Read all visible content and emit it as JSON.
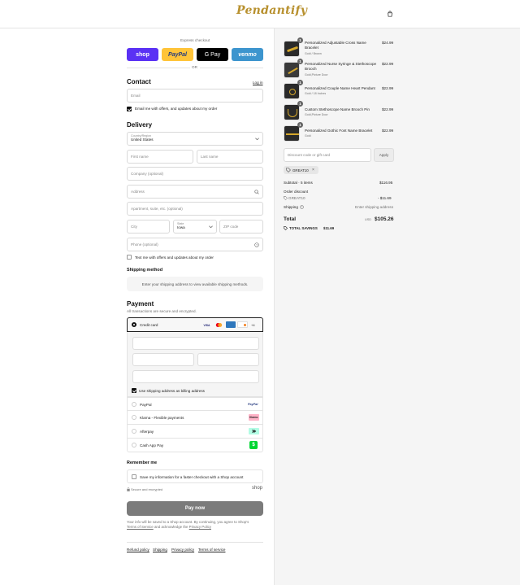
{
  "header": {
    "logo_text": "Pendantify",
    "cart_icon": "shopping-bag-icon"
  },
  "express": {
    "label": "Express checkout",
    "buttons": [
      "shop",
      "PayPal",
      "G Pay",
      "venmo"
    ],
    "or": "OR"
  },
  "contact": {
    "title": "Contact",
    "login": "Log in",
    "email_placeholder": "Email",
    "offers_label": "Email me with offers, and updates about my order"
  },
  "delivery": {
    "title": "Delivery",
    "country_label": "Country/Region",
    "country_value": "United States",
    "first_name": "First name",
    "last_name": "Last name",
    "company": "Company (optional)",
    "address": "Address",
    "apartment": "Apartment, suite, etc. (optional)",
    "city": "City",
    "state_label": "State",
    "state_value": "Iowa",
    "zip": "ZIP code",
    "phone": "Phone (optional)",
    "text_offers": "Text me with offers and updates about my order"
  },
  "shipping_method": {
    "title": "Shipping method",
    "notice": "Enter your shipping address to view available shipping methods."
  },
  "payment": {
    "title": "Payment",
    "subtitle": "All transactions are secure and encrypted.",
    "credit_card": "Credit card",
    "card_badges": [
      "VISA",
      "MC",
      "AMEX",
      "DISCOVER",
      "+4"
    ],
    "billing_same": "Use shipping address as billing address",
    "options": [
      {
        "label": "PayPal",
        "badge": "PayPal"
      },
      {
        "label": "Klarna - Flexible payments",
        "badge": "Klarna."
      },
      {
        "label": "Afterpay",
        "badge": "afterpay"
      },
      {
        "label": "Cash App Pay",
        "badge": "$"
      }
    ]
  },
  "remember": {
    "title": "Remember me",
    "save_label": "Save my information for a faster checkout with a Shop account",
    "secure": "Secure and encrypted",
    "shop": "shop"
  },
  "pay_now": "Pay now",
  "legal": {
    "line1": "Your info will be saved to a Shop account. By continuing, you agree to Shop's",
    "tos": "Terms of Service",
    "and": "and acknowledge the",
    "privacy": "Privacy Policy"
  },
  "footer_links": [
    "Refund policy",
    "Shipping",
    "Privacy policy",
    "Terms of service"
  ],
  "order": {
    "items": [
      {
        "qty": "1",
        "name": "Personalized Adjustable Cross Name Bracelet",
        "variant": "Gold / Brown",
        "price": "$24.99"
      },
      {
        "qty": "1",
        "name": "Personalized Nurse Syringe & Stethoscope Brooch",
        "variant": "Gold,Picture Door",
        "price": "$22.99"
      },
      {
        "qty": "1",
        "name": "Personalized Couple Name Heart Pendant",
        "variant": "Gold / 18 Inches",
        "price": "$22.99"
      },
      {
        "qty": "1",
        "name": "Custom Stethoscope Name Brooch Pin",
        "variant": "Gold,Picture Door",
        "price": "$22.99"
      },
      {
        "qty": "1",
        "name": "Personalized Gothic Font Name Bracelet",
        "variant": "Gold",
        "price": "$22.99"
      }
    ],
    "discount_placeholder": "Discount code or gift card",
    "apply": "Apply",
    "applied_code": "GREAT10",
    "subtotal_label": "Subtotal · 5 items",
    "subtotal": "$116.95",
    "order_discount": "Order discount",
    "discount_code": "GREAT10",
    "discount_amount": "- $11.69",
    "shipping_label": "Shipping",
    "shipping_value": "Enter shipping address",
    "total_label": "Total",
    "currency": "USD",
    "total": "$105.26",
    "savings_label": "TOTAL SAVINGS",
    "savings": "$11.69"
  }
}
